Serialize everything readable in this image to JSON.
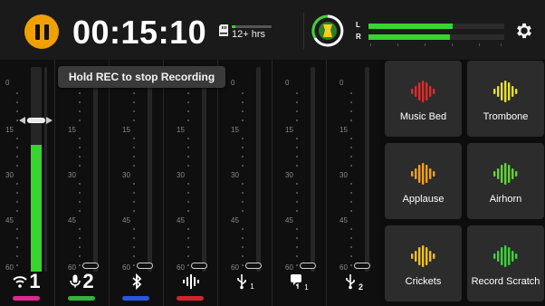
{
  "topbar": {
    "timer": "00:15:10",
    "storage_text": "12+ hrs",
    "storage_used": 0.1,
    "meter_left_label": "L",
    "meter_right_label": "R",
    "meter_left_level": 0.62,
    "meter_right_level": 0.6
  },
  "mixer": {
    "toast": "Hold REC to stop Recording",
    "scale_ticks": [
      "0",
      "15",
      "30",
      "45",
      "60"
    ],
    "channels": [
      {
        "icon": "wireless-icon",
        "number": "1",
        "color": "#e0268f",
        "level": 0.62,
        "fader": 0.74
      },
      {
        "icon": "microphone-icon",
        "number": "2",
        "color": "#32b33a",
        "level": 0,
        "fader": 0
      },
      {
        "icon": "bluetooth-icon",
        "number": "",
        "color": "#2757e0",
        "level": 0,
        "fader": 0
      },
      {
        "icon": "soundpad-icon",
        "number": "",
        "color": "#d3232a",
        "level": 0,
        "fader": 0
      },
      {
        "icon": "usb-1-icon",
        "number": "1",
        "color": "",
        "level": 0,
        "fader": 0
      },
      {
        "icon": "usb-chat-icon",
        "number": "1",
        "color": "",
        "level": 0,
        "fader": 0
      },
      {
        "icon": "usb-2-icon",
        "number": "2",
        "color": "",
        "level": 0,
        "fader": 0
      }
    ]
  },
  "pads": [
    {
      "label": "Music Bed",
      "color": "#e02a2a"
    },
    {
      "label": "Trombone",
      "color": "#e7e02a"
    },
    {
      "label": "Applause",
      "color": "#f3a020"
    },
    {
      "label": "Airhorn",
      "color": "#62d23a"
    },
    {
      "label": "Crickets",
      "color": "#f0c020"
    },
    {
      "label": "Record Scratch",
      "color": "#3ed23a"
    }
  ]
}
